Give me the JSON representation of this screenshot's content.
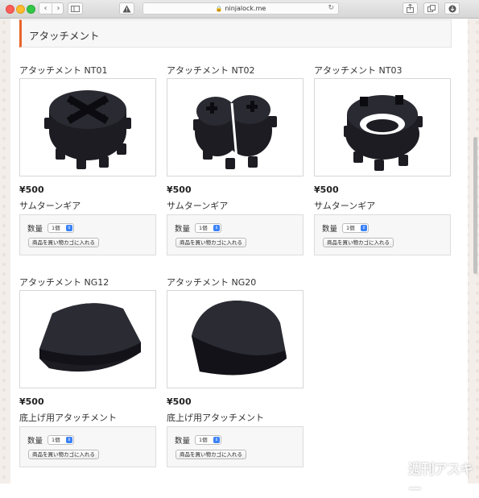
{
  "browser": {
    "url": "ninjalock.me"
  },
  "section": {
    "title": "アタッチメント"
  },
  "products": [
    {
      "name": "アタッチメント NT01",
      "price": "¥500",
      "description": "サムターンギア",
      "quantity_label": "数量",
      "quantity_value": "1個",
      "add_to_cart": "商品を買い物カゴに入れる",
      "image": "gear-four-slot"
    },
    {
      "name": "アタッチメント NT02",
      "price": "¥500",
      "description": "サムターンギア",
      "quantity_label": "数量",
      "quantity_value": "1個",
      "add_to_cart": "商品を買い物カゴに入れる",
      "image": "gear-split"
    },
    {
      "name": "アタッチメント NT03",
      "price": "¥500",
      "description": "サムターンギア",
      "quantity_label": "数量",
      "quantity_value": "1個",
      "add_to_cart": "商品を買い物カゴに入れる",
      "image": "gear-oval"
    },
    {
      "name": "アタッチメント NG12",
      "price": "¥500",
      "description": "底上げ用アタッチメント",
      "quantity_label": "数量",
      "quantity_value": "1個",
      "add_to_cart": "商品を買い物カゴに入れる",
      "image": "base-flat"
    },
    {
      "name": "アタッチメント NG20",
      "price": "¥500",
      "description": "底上げ用アタッチメント",
      "quantity_label": "数量",
      "quantity_value": "1個",
      "add_to_cart": "商品を買い物カゴに入れる",
      "image": "base-tall"
    }
  ],
  "watermark": "週刊アスキー",
  "colors": {
    "accent": "#e8642b",
    "select_arrow": "#3b82f6",
    "part_black": "#1c1c22"
  }
}
